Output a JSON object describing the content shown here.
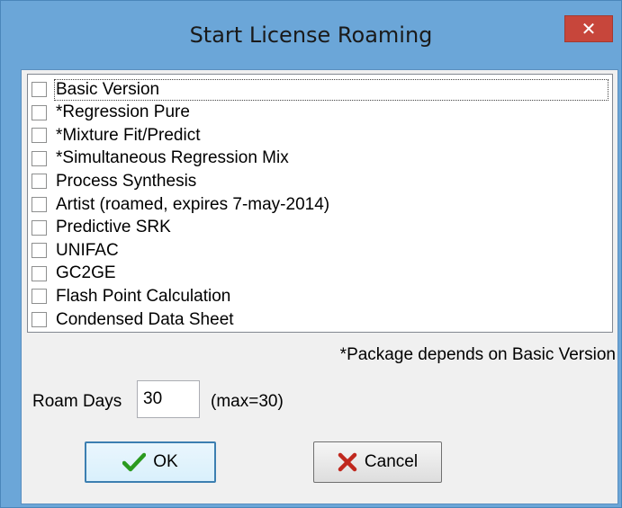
{
  "window": {
    "title": "Start License Roaming",
    "close_glyph": "✕"
  },
  "packages": [
    {
      "label": "Basic Version",
      "checked": false,
      "focused": true
    },
    {
      "label": "*Regression Pure",
      "checked": false
    },
    {
      "label": "*Mixture Fit/Predict",
      "checked": false
    },
    {
      "label": "*Simultaneous Regression Mix",
      "checked": false
    },
    {
      "label": "Process Synthesis",
      "checked": false
    },
    {
      "label": "Artist (roamed, expires 7-may-2014)",
      "checked": false
    },
    {
      "label": "Predictive SRK",
      "checked": false
    },
    {
      "label": "UNIFAC",
      "checked": false
    },
    {
      "label": "GC2GE",
      "checked": false
    },
    {
      "label": "Flash Point Calculation",
      "checked": false
    },
    {
      "label": "Condensed Data Sheet",
      "checked": false
    }
  ],
  "note": "*Package depends on Basic Version",
  "roam": {
    "label": "Roam Days",
    "value": "30",
    "max_text": "(max=30)"
  },
  "buttons": {
    "ok_label": "OK",
    "cancel_label": "Cancel",
    "ok_icon": "checkmark-icon",
    "cancel_icon": "x-mark-icon"
  },
  "colors": {
    "frame": "#6ba6d8",
    "close": "#c7463b",
    "ok_check": "#2a9a1e",
    "cancel_x": "#c0281e"
  }
}
